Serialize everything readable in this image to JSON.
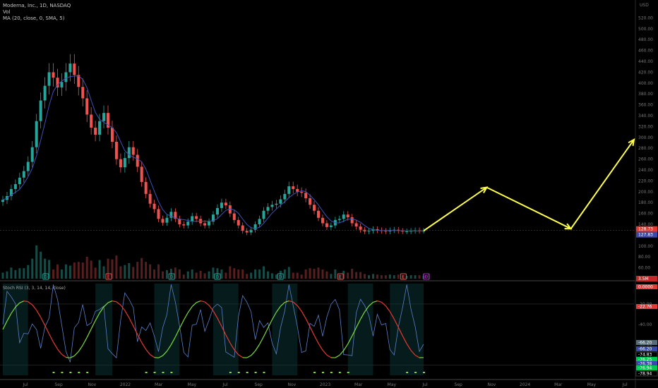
{
  "header": {
    "title": "Moderna, Inc., 1D, NASDAQ",
    "vol_label": "Vol",
    "ma_label": "MA (20, close, 0, SMA, 5)",
    "indicator_label": "Stoch RSI (3, 3, 14, 14, close)",
    "currency": "USD"
  },
  "colors": {
    "background": "#000000",
    "up_candle": "#26a69a",
    "down_candle": "#ef5350",
    "ma_line": "#3f51b5",
    "projection_arrow": "#ffff4d",
    "indicator_line": "#5b7fc8",
    "signal_red": "#e53935",
    "signal_green": "#7cdc3a",
    "axis_text": "#787878"
  },
  "price_axis": {
    "ticks": [
      "520.00",
      "500.00",
      "480.00",
      "460.00",
      "440.00",
      "420.00",
      "400.00",
      "380.00",
      "360.00",
      "340.00",
      "320.00",
      "300.00",
      "280.00",
      "260.00",
      "240.00",
      "220.00",
      "200.00",
      "180.00",
      "160.00",
      "140.00",
      "120.00",
      "100.00",
      "80.00",
      "60.00",
      "40.00"
    ],
    "last_price_red": "128.73",
    "last_price_blue": "127.83",
    "volume_tag": "3.5M"
  },
  "indicator_axis": {
    "ticks": [
      "-20.00",
      "-40.00",
      "-60.00",
      "-80.00"
    ],
    "tags": [
      {
        "text": "0.0000",
        "color": "#e53935"
      },
      {
        "text": "-22.76",
        "color": "#e53935"
      },
      {
        "text": "-66.20",
        "color": "#546e7a"
      },
      {
        "text": "-66.20",
        "color": "#3949ab"
      },
      {
        "text": "-74.83",
        "color": "#000000"
      },
      {
        "text": "-76.25",
        "color": "#00c853"
      },
      {
        "text": "-76.38",
        "color": "#3949ab"
      },
      {
        "text": "-76.94",
        "color": "#00c853"
      },
      {
        "text": "-78.94",
        "color": "#000000"
      }
    ]
  },
  "x_axis": {
    "labels": [
      "Jul",
      "Sep",
      "Nov",
      "2022",
      "Mar",
      "May",
      "Jul",
      "Sep",
      "Nov",
      "2023",
      "Mar",
      "May",
      "Jul",
      "Sep",
      "Nov",
      "2024",
      "Mar",
      "May",
      "Jul"
    ]
  },
  "event_markers": [
    {
      "symbol": "D",
      "color": "#26a69a"
    },
    {
      "symbol": "E",
      "color": "#ef5350"
    },
    {
      "symbol": "D",
      "color": "#26a69a"
    },
    {
      "symbol": "D",
      "color": "#26a69a"
    },
    {
      "symbol": "D",
      "color": "#26a69a"
    },
    {
      "symbol": "E",
      "color": "#ef5350"
    },
    {
      "symbol": "E",
      "color": "#ef5350"
    },
    {
      "symbol": "D",
      "color": "#26a69a"
    },
    {
      "symbol": "E",
      "color": "#ef5350"
    },
    {
      "symbol": "D",
      "color": "#9c27b0"
    },
    {
      "symbol": "E",
      "color": "#9c27b0"
    }
  ],
  "chart_data": {
    "type": "line",
    "x_unit": "trading period (2021-06 to 2023-06)",
    "price_series": {
      "x": [
        0,
        1,
        2,
        3,
        4,
        5,
        6,
        7,
        8,
        9,
        10,
        11,
        12,
        13,
        14,
        15,
        16,
        17,
        18,
        19,
        20,
        21,
        22,
        23,
        24,
        25,
        26,
        27,
        28,
        29,
        30,
        31,
        32,
        33,
        34,
        35,
        36,
        37,
        38,
        39,
        40,
        41,
        42,
        43,
        44,
        45,
        46,
        47,
        48,
        49,
        50,
        51,
        52,
        53,
        54,
        55,
        56,
        57,
        58,
        59,
        60,
        61,
        62,
        63,
        64,
        65,
        66,
        67,
        68,
        69,
        70,
        71,
        72,
        73,
        74,
        75,
        76,
        77,
        78,
        79,
        80,
        81,
        82,
        83,
        84,
        85,
        86,
        87,
        88,
        89,
        90,
        91,
        92,
        93,
        94,
        95,
        96,
        97,
        98,
        99,
        100
      ],
      "close": [
        185,
        192,
        205,
        214,
        226,
        238,
        255,
        282,
        330,
        368,
        395,
        420,
        410,
        392,
        402,
        420,
        436,
        415,
        393,
        372,
        342,
        318,
        305,
        330,
        345,
        318,
        292,
        260,
        245,
        262,
        282,
        268,
        246,
        218,
        196,
        178,
        168,
        150,
        143,
        152,
        163,
        150,
        140,
        138,
        145,
        155,
        150,
        142,
        138,
        145,
        158,
        170,
        180,
        175,
        160,
        148,
        138,
        128,
        125,
        130,
        140,
        150,
        165,
        172,
        176,
        178,
        186,
        196,
        210,
        205,
        200,
        198,
        188,
        176,
        165,
        152,
        142,
        135,
        138,
        148,
        150,
        158,
        153,
        142,
        136,
        130,
        127,
        128,
        131,
        129,
        128,
        127,
        129,
        130,
        128,
        127,
        127,
        128,
        129,
        128,
        128
      ]
    },
    "projection": {
      "x": [
        100,
        115,
        135,
        150
      ],
      "y": [
        128,
        208,
        132,
        296
      ],
      "note_points": [
        "2023-06",
        "2023-08",
        "2023-12",
        "2024-05"
      ]
    },
    "stoch_rsi_range": [
      -80,
      0
    ]
  }
}
